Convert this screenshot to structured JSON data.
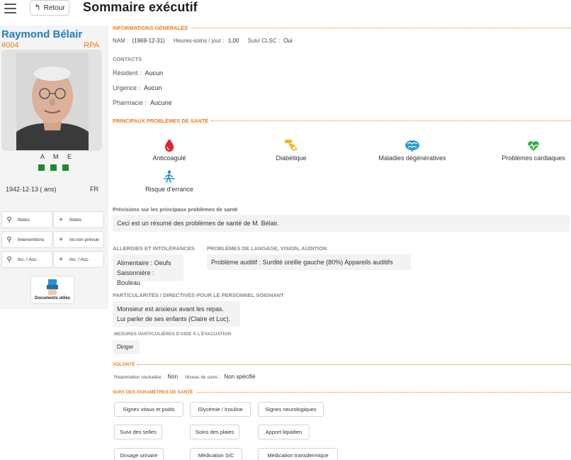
{
  "header": {
    "back_label": "Retour",
    "title": "Sommaire exécutif"
  },
  "patient": {
    "name": "Raymond Bélair",
    "id": "#004",
    "type": "RPA",
    "ame_label": "A M E",
    "dob": "1942-12-13 ( ans)",
    "language": "FR"
  },
  "quick_actions": [
    {
      "icon": "search-icon",
      "label": "Notes"
    },
    {
      "icon": "plus-icon",
      "label": "Notes"
    },
    {
      "icon": "search-icon",
      "label": "Interventions"
    },
    {
      "icon": "plus-icon",
      "label": "Int.non prévue"
    },
    {
      "icon": "search-icon",
      "label": "Inc. / Acc."
    },
    {
      "icon": "plus-icon",
      "label": "Inc. / Acc."
    }
  ],
  "documents_label": "Documents utiles",
  "general": {
    "heading": "INFORMATIONS GÉNÉRALES",
    "nam_label": "NAM :",
    "nam_value": "(1969-12-31)",
    "hours_label": "Heures-soins / jour :",
    "hours_value": "1,00",
    "clsc_label": "Suivi CLSC :",
    "clsc_value": "Oui"
  },
  "contacts": {
    "heading": "CONTACTS",
    "resident_label": "Résident :",
    "resident_value": "Aucun",
    "urgence_label": "Urgence :",
    "urgence_value": "Aucun",
    "pharmacie_label": "Pharmacie :",
    "pharmacie_value": "Aucune"
  },
  "health": {
    "heading": "PRINCIPAUX PROBLÈMES DE SANTÉ",
    "problems": [
      {
        "icon": "blood-drop-icon",
        "label": "Anticoagulé",
        "color": "#e0262b"
      },
      {
        "icon": "glucose-meter-icon",
        "label": "Diabétique",
        "color": "#f2b51e"
      },
      {
        "icon": "brain-icon",
        "label": "Maladies dégénératives",
        "color": "#2a9bd6"
      },
      {
        "icon": "heartbeat-icon",
        "label": "Problèmes cardiaques",
        "color": "#27b04a"
      },
      {
        "icon": "walking-person-icon",
        "label": "Risque d'errance",
        "color": "#2a8fd0"
      }
    ],
    "precisions_heading": "Précisions sur les principaux problèmes de santé",
    "precisions_text": "Ceci est un résumé des problèmes de santé de M. Bélair."
  },
  "allergies": {
    "heading": "ALLERGIES ET INTOLÉRANCES",
    "line1": "Alimentaire : Oeufs",
    "line2": "Saisonnière : Bouleau"
  },
  "language_problems": {
    "heading": "PROBLÈMES DE LANGAGE, VISION, AUDITION",
    "text": "Problème auditif : Surdité oreille gauche (80%) Appareils auditifs"
  },
  "directives": {
    "heading": "PARTICULARITÉS / DIRECTIVES POUR LE PERSONNEL SOIGNANT",
    "line1": "Monsieur est anxieux avant les repas.",
    "line2": "Lui parler de ses enfants (Claire et Luc).",
    "evac_heading": "MESURES PARTICULIÈRES D'AIDE À L'ÉVACUATION",
    "evac_text": "Diriger"
  },
  "volonte": {
    "heading": "VOLONTÉ",
    "reanimation_label": "Réanimation souhaitée :",
    "reanimation_value": "Non",
    "soins_label": "Niveau de soins :",
    "soins_value": "Non spécifié"
  },
  "parametres": {
    "heading": "SUIVI DES PARAMÈTRES DE SANTÉ",
    "buttons": [
      "Signes vitaux et poids",
      "Glycémie / Insuline",
      "Signes neurologiques",
      "Suivi des selles",
      "Soins des plaies",
      "Apport liquidien",
      "Dosage urinaire",
      "Médication S/C",
      "Médication transdermique"
    ]
  },
  "colors": {
    "accent_orange": "#f07a1e",
    "name_blue": "#1f7fc0",
    "ame_green": "#1d8a2d"
  }
}
